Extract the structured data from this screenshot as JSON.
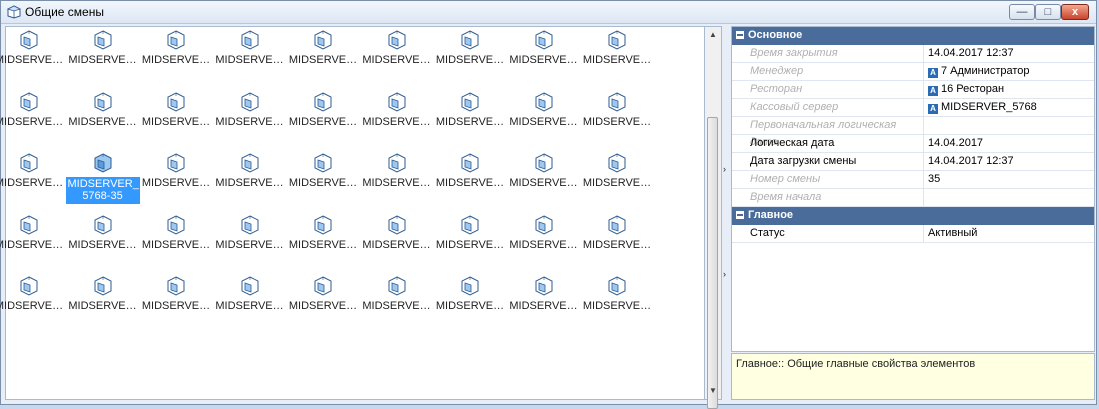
{
  "window": {
    "title": "Общие смены",
    "title_icon": "shift-cube-icon",
    "buttons": {
      "minimize": "—",
      "maximize": "□",
      "close": "x"
    }
  },
  "grid": {
    "icon": "midserver-shift-icon",
    "default_label": "MIDSERVE…",
    "rows": [
      [
        "MIDSERVE…",
        "MIDSERVE…",
        "MIDSERVE…",
        "MIDSERVE…",
        "MIDSERVE…",
        "MIDSERVE…",
        "MIDSERVE…",
        "MIDSERVE…",
        "MIDSERVE…"
      ],
      [
        "MIDSERVE…",
        "MIDSERVE…",
        "MIDSERVE…",
        "MIDSERVE…",
        "MIDSERVE…",
        "MIDSERVE…",
        "MIDSERVE…",
        "MIDSERVE…",
        "MIDSERVE…"
      ],
      [
        "MIDSERVE…",
        "MIDSERVER_ 5768-35",
        "MIDSERVE…",
        "MIDSERVE…",
        "MIDSERVE…",
        "MIDSERVE…",
        "MIDSERVE…",
        "MIDSERVE…",
        "MIDSERVE…"
      ],
      [
        "MIDSERVE…",
        "MIDSERVE…",
        "MIDSERVE…",
        "MIDSERVE…",
        "MIDSERVE…",
        "MIDSERVE…",
        "MIDSERVE…",
        "MIDSERVE…",
        "MIDSERVE…"
      ],
      [
        "MIDSERVE…",
        "MIDSERVE…",
        "MIDSERVE…",
        "MIDSERVE…",
        "MIDSERVE…",
        "MIDSERVE…",
        "MIDSERVE…",
        "MIDSERVE…",
        "MIDSERVE…"
      ]
    ],
    "selected": {
      "row": 2,
      "col": 1
    }
  },
  "properties": {
    "categories": [
      {
        "title": "Основное",
        "rows": [
          {
            "name": "Время закрытия",
            "value": "14.04.2017 12:37",
            "enabled": false,
            "ref": false
          },
          {
            "name": "Менеджер",
            "value": "7 Администратор",
            "enabled": false,
            "ref": true
          },
          {
            "name": "Ресторан",
            "value": "16 Ресторан",
            "enabled": false,
            "ref": true
          },
          {
            "name": "Кассовый сервер",
            "value": "MIDSERVER_5768",
            "enabled": false,
            "ref": true
          },
          {
            "name": "Первоначальная логическая дата",
            "value": "",
            "enabled": false,
            "ref": false
          },
          {
            "name": "Логическая дата",
            "value": "14.04.2017",
            "enabled": true,
            "ref": false
          },
          {
            "name": "Дата загрузки смены",
            "value": "14.04.2017 12:37",
            "enabled": true,
            "ref": false
          },
          {
            "name": "Номер смены",
            "value": "35",
            "enabled": false,
            "ref": false
          },
          {
            "name": "Время начала",
            "value": "",
            "enabled": false,
            "ref": false
          }
        ]
      },
      {
        "title": "Главное",
        "rows": [
          {
            "name": "Статус",
            "value": "Активный",
            "enabled": true,
            "ref": false
          }
        ]
      }
    ],
    "ref_glyph": "A",
    "description": "Главное:: Общие главные свойства элементов"
  },
  "colors": {
    "category_bg": "#4a6c9b",
    "selection": "#3399ff",
    "description_bg": "#ffffe1"
  }
}
